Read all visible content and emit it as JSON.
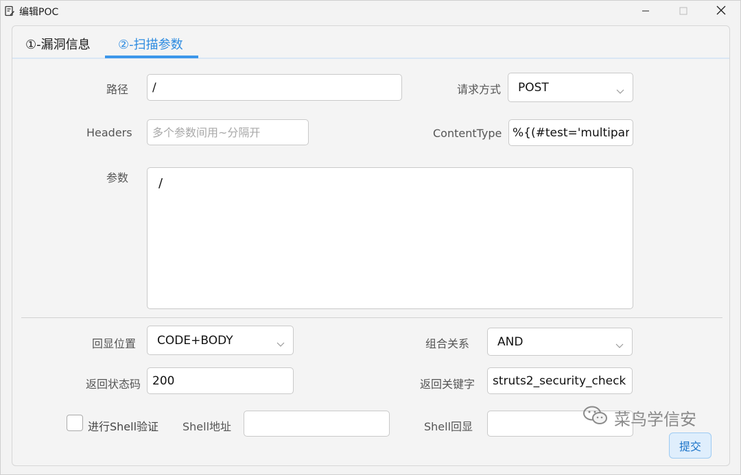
{
  "window": {
    "title": "编辑POC",
    "icons": {
      "app": "document-edit-icon",
      "minimize": "minimize-icon",
      "maximize": "maximize-icon",
      "close": "close-icon"
    }
  },
  "tabs": [
    {
      "label": "①-漏洞信息",
      "active": false
    },
    {
      "label": "②-扫描参数",
      "active": true
    }
  ],
  "form": {
    "path": {
      "label": "路径",
      "value": "/"
    },
    "method": {
      "label": "请求方式",
      "value": "POST"
    },
    "headers": {
      "label": "Headers",
      "value": "",
      "placeholder": "多个参数间用~分隔开"
    },
    "content_type": {
      "label": "ContentType",
      "value": "%{(#test='multipart/fo"
    },
    "params": {
      "label": "参数",
      "value": "/"
    },
    "echo_position": {
      "label": "回显位置",
      "value": "CODE+BODY"
    },
    "combine": {
      "label": "组合关系",
      "value": "AND"
    },
    "status_code": {
      "label": "返回状态码",
      "value": "200"
    },
    "keyword": {
      "label": "返回关键字",
      "value": "struts2_security_check"
    },
    "shell_verify": {
      "label": "进行Shell验证",
      "checked": false
    },
    "shell_addr": {
      "label": "Shell地址",
      "value": ""
    },
    "shell_echo": {
      "label": "Shell回显",
      "value": ""
    }
  },
  "submit_label": "提交",
  "watermark": "菜鸟学信安",
  "colors": {
    "accent": "#2d8be0",
    "tab_underline": "#3c97ea"
  }
}
